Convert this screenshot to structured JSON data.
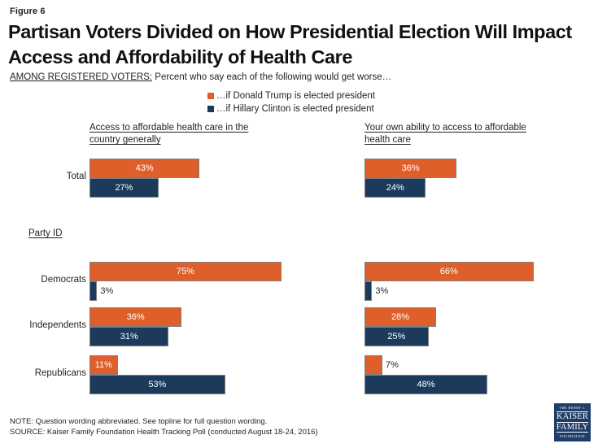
{
  "figure": {
    "label": "Figure 6"
  },
  "title": "Partisan Voters Divided on How Presidential Election Will Impact Access and Affordability of Health Care",
  "subtitle": {
    "lead": "AMONG REGISTERED VOTERS:",
    "rest": " Percent who say each of the following would get worse…"
  },
  "legend": {
    "items": [
      {
        "label": "…if Donald Trump is elected president",
        "color": "#DF5F2A",
        "key": "trump"
      },
      {
        "label": "…if Hillary Clinton is elected president",
        "color": "#1B3A5C",
        "key": "clinton"
      }
    ]
  },
  "section_label": "Party ID",
  "footnotes": {
    "note": "NOTE: Question wording abbreviated. See topline for full question wording.",
    "source": "SOURCE: Kaiser Family Foundation Health Tracking Poll (conducted August 18-24, 2016)"
  },
  "logo": {
    "line1": "THE HENRY J.",
    "line2": "KAISER",
    "line3": "FAMILY",
    "line4": "FOUNDATION"
  },
  "chart_data": {
    "type": "bar",
    "title": "Partisan Voters Divided on How Presidential Election Will Impact Access and Affordability of Health Care",
    "subtitle": "AMONG REGISTERED VOTERS: Percent who say each of the following would get worse…",
    "orientation": "horizontal",
    "grouped": true,
    "grid": false,
    "legend_position": "top-center",
    "xlabel": "",
    "ylabel": "",
    "xlim": [
      0,
      100
    ],
    "value_suffix": "%",
    "panels": [
      {
        "header": "Access to affordable health care in the country generally",
        "categories": [
          "Total",
          "Democrats",
          "Independents",
          "Republicans"
        ],
        "series": [
          {
            "name": "…if Donald Trump is elected president",
            "color": "#DF5F2A",
            "values": [
              43,
              75,
              36,
              11
            ]
          },
          {
            "name": "…if Hillary Clinton is elected president",
            "color": "#1B3A5C",
            "values": [
              27,
              3,
              31,
              53
            ]
          }
        ]
      },
      {
        "header": "Your own ability to access to affordable health care",
        "categories": [
          "Total",
          "Democrats",
          "Independents",
          "Republicans"
        ],
        "series": [
          {
            "name": "…if Donald Trump is elected president",
            "color": "#DF5F2A",
            "values": [
              36,
              66,
              28,
              7
            ]
          },
          {
            "name": "…if Hillary Clinton is elected president",
            "color": "#1B3A5C",
            "values": [
              24,
              3,
              25,
              48
            ]
          }
        ]
      }
    ],
    "labels": {
      "panel_0": {
        "trump": [
          "43%",
          "75%",
          "36%",
          "11%"
        ],
        "clinton": [
          "27%",
          "3%",
          "31%",
          "53%"
        ]
      },
      "panel_1": {
        "trump": [
          "36%",
          "66%",
          "28%",
          "7%"
        ],
        "clinton": [
          "24%",
          "3%",
          "25%",
          "48%"
        ]
      }
    }
  }
}
